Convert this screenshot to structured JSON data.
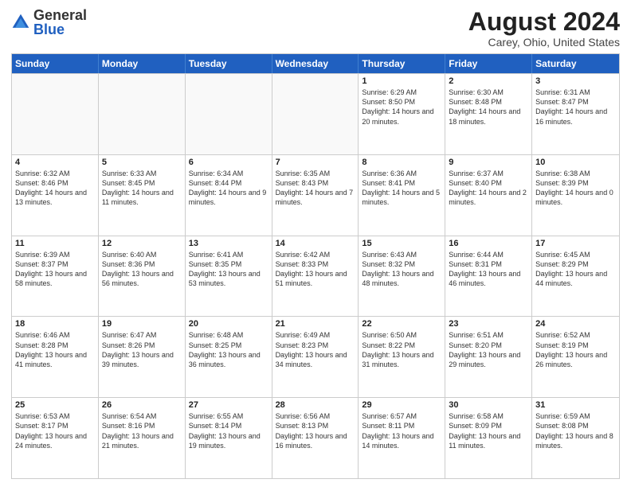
{
  "logo": {
    "general": "General",
    "blue": "Blue"
  },
  "title": "August 2024",
  "location": "Carey, Ohio, United States",
  "headers": [
    "Sunday",
    "Monday",
    "Tuesday",
    "Wednesday",
    "Thursday",
    "Friday",
    "Saturday"
  ],
  "rows": [
    [
      {
        "day": "",
        "info": ""
      },
      {
        "day": "",
        "info": ""
      },
      {
        "day": "",
        "info": ""
      },
      {
        "day": "",
        "info": ""
      },
      {
        "day": "1",
        "info": "Sunrise: 6:29 AM\nSunset: 8:50 PM\nDaylight: 14 hours and 20 minutes."
      },
      {
        "day": "2",
        "info": "Sunrise: 6:30 AM\nSunset: 8:48 PM\nDaylight: 14 hours and 18 minutes."
      },
      {
        "day": "3",
        "info": "Sunrise: 6:31 AM\nSunset: 8:47 PM\nDaylight: 14 hours and 16 minutes."
      }
    ],
    [
      {
        "day": "4",
        "info": "Sunrise: 6:32 AM\nSunset: 8:46 PM\nDaylight: 14 hours and 13 minutes."
      },
      {
        "day": "5",
        "info": "Sunrise: 6:33 AM\nSunset: 8:45 PM\nDaylight: 14 hours and 11 minutes."
      },
      {
        "day": "6",
        "info": "Sunrise: 6:34 AM\nSunset: 8:44 PM\nDaylight: 14 hours and 9 minutes."
      },
      {
        "day": "7",
        "info": "Sunrise: 6:35 AM\nSunset: 8:43 PM\nDaylight: 14 hours and 7 minutes."
      },
      {
        "day": "8",
        "info": "Sunrise: 6:36 AM\nSunset: 8:41 PM\nDaylight: 14 hours and 5 minutes."
      },
      {
        "day": "9",
        "info": "Sunrise: 6:37 AM\nSunset: 8:40 PM\nDaylight: 14 hours and 2 minutes."
      },
      {
        "day": "10",
        "info": "Sunrise: 6:38 AM\nSunset: 8:39 PM\nDaylight: 14 hours and 0 minutes."
      }
    ],
    [
      {
        "day": "11",
        "info": "Sunrise: 6:39 AM\nSunset: 8:37 PM\nDaylight: 13 hours and 58 minutes."
      },
      {
        "day": "12",
        "info": "Sunrise: 6:40 AM\nSunset: 8:36 PM\nDaylight: 13 hours and 56 minutes."
      },
      {
        "day": "13",
        "info": "Sunrise: 6:41 AM\nSunset: 8:35 PM\nDaylight: 13 hours and 53 minutes."
      },
      {
        "day": "14",
        "info": "Sunrise: 6:42 AM\nSunset: 8:33 PM\nDaylight: 13 hours and 51 minutes."
      },
      {
        "day": "15",
        "info": "Sunrise: 6:43 AM\nSunset: 8:32 PM\nDaylight: 13 hours and 48 minutes."
      },
      {
        "day": "16",
        "info": "Sunrise: 6:44 AM\nSunset: 8:31 PM\nDaylight: 13 hours and 46 minutes."
      },
      {
        "day": "17",
        "info": "Sunrise: 6:45 AM\nSunset: 8:29 PM\nDaylight: 13 hours and 44 minutes."
      }
    ],
    [
      {
        "day": "18",
        "info": "Sunrise: 6:46 AM\nSunset: 8:28 PM\nDaylight: 13 hours and 41 minutes."
      },
      {
        "day": "19",
        "info": "Sunrise: 6:47 AM\nSunset: 8:26 PM\nDaylight: 13 hours and 39 minutes."
      },
      {
        "day": "20",
        "info": "Sunrise: 6:48 AM\nSunset: 8:25 PM\nDaylight: 13 hours and 36 minutes."
      },
      {
        "day": "21",
        "info": "Sunrise: 6:49 AM\nSunset: 8:23 PM\nDaylight: 13 hours and 34 minutes."
      },
      {
        "day": "22",
        "info": "Sunrise: 6:50 AM\nSunset: 8:22 PM\nDaylight: 13 hours and 31 minutes."
      },
      {
        "day": "23",
        "info": "Sunrise: 6:51 AM\nSunset: 8:20 PM\nDaylight: 13 hours and 29 minutes."
      },
      {
        "day": "24",
        "info": "Sunrise: 6:52 AM\nSunset: 8:19 PM\nDaylight: 13 hours and 26 minutes."
      }
    ],
    [
      {
        "day": "25",
        "info": "Sunrise: 6:53 AM\nSunset: 8:17 PM\nDaylight: 13 hours and 24 minutes."
      },
      {
        "day": "26",
        "info": "Sunrise: 6:54 AM\nSunset: 8:16 PM\nDaylight: 13 hours and 21 minutes."
      },
      {
        "day": "27",
        "info": "Sunrise: 6:55 AM\nSunset: 8:14 PM\nDaylight: 13 hours and 19 minutes."
      },
      {
        "day": "28",
        "info": "Sunrise: 6:56 AM\nSunset: 8:13 PM\nDaylight: 13 hours and 16 minutes."
      },
      {
        "day": "29",
        "info": "Sunrise: 6:57 AM\nSunset: 8:11 PM\nDaylight: 13 hours and 14 minutes."
      },
      {
        "day": "30",
        "info": "Sunrise: 6:58 AM\nSunset: 8:09 PM\nDaylight: 13 hours and 11 minutes."
      },
      {
        "day": "31",
        "info": "Sunrise: 6:59 AM\nSunset: 8:08 PM\nDaylight: 13 hours and 8 minutes."
      }
    ]
  ]
}
